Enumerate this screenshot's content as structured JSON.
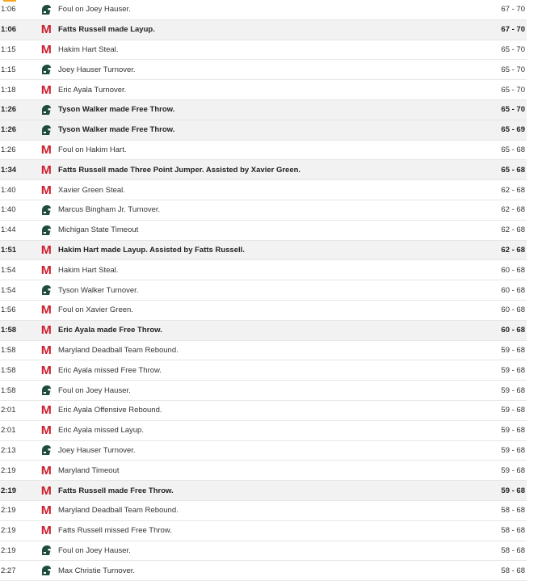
{
  "colors": {
    "maryland_red": "#cc1f2f",
    "msu_green": "#1f4d3c",
    "scoring_row_bg": "#f2f2f2",
    "row_border": "#e6e6e6"
  },
  "teams": {
    "md": {
      "icon": "maryland-m-logo-icon"
    },
    "msu": {
      "icon": "spartan-helmet-logo-icon"
    }
  },
  "plays": [
    {
      "time": "1:06",
      "team": "msu",
      "desc": "Foul on Joey Hauser.",
      "score": "67 - 70",
      "scoring": false
    },
    {
      "time": "1:06",
      "team": "md",
      "desc": "Fatts Russell made Layup.",
      "score": "67 - 70",
      "scoring": true
    },
    {
      "time": "1:15",
      "team": "md",
      "desc": "Hakim Hart Steal.",
      "score": "65 - 70",
      "scoring": false
    },
    {
      "time": "1:15",
      "team": "msu",
      "desc": "Joey Hauser Turnover.",
      "score": "65 - 70",
      "scoring": false
    },
    {
      "time": "1:18",
      "team": "md",
      "desc": "Eric Ayala Turnover.",
      "score": "65 - 70",
      "scoring": false
    },
    {
      "time": "1:26",
      "team": "msu",
      "desc": "Tyson Walker made Free Throw.",
      "score": "65 - 70",
      "scoring": true
    },
    {
      "time": "1:26",
      "team": "msu",
      "desc": "Tyson Walker made Free Throw.",
      "score": "65 - 69",
      "scoring": true
    },
    {
      "time": "1:26",
      "team": "md",
      "desc": "Foul on Hakim Hart.",
      "score": "65 - 68",
      "scoring": false
    },
    {
      "time": "1:34",
      "team": "md",
      "desc": "Fatts Russell made Three Point Jumper. Assisted by Xavier Green.",
      "score": "65 - 68",
      "scoring": true
    },
    {
      "time": "1:40",
      "team": "md",
      "desc": "Xavier Green Steal.",
      "score": "62 - 68",
      "scoring": false
    },
    {
      "time": "1:40",
      "team": "msu",
      "desc": "Marcus Bingham Jr. Turnover.",
      "score": "62 - 68",
      "scoring": false
    },
    {
      "time": "1:44",
      "team": "msu",
      "desc": "Michigan State Timeout",
      "score": "62 - 68",
      "scoring": false
    },
    {
      "time": "1:51",
      "team": "md",
      "desc": "Hakim Hart made Layup. Assisted by Fatts Russell.",
      "score": "62 - 68",
      "scoring": true
    },
    {
      "time": "1:54",
      "team": "md",
      "desc": "Hakim Hart Steal.",
      "score": "60 - 68",
      "scoring": false
    },
    {
      "time": "1:54",
      "team": "msu",
      "desc": "Tyson Walker Turnover.",
      "score": "60 - 68",
      "scoring": false
    },
    {
      "time": "1:56",
      "team": "md",
      "desc": "Foul on Xavier Green.",
      "score": "60 - 68",
      "scoring": false
    },
    {
      "time": "1:58",
      "team": "md",
      "desc": "Eric Ayala made Free Throw.",
      "score": "60 - 68",
      "scoring": true
    },
    {
      "time": "1:58",
      "team": "md",
      "desc": "Maryland Deadball Team Rebound.",
      "score": "59 - 68",
      "scoring": false
    },
    {
      "time": "1:58",
      "team": "md",
      "desc": "Eric Ayala missed Free Throw.",
      "score": "59 - 68",
      "scoring": false
    },
    {
      "time": "1:58",
      "team": "msu",
      "desc": "Foul on Joey Hauser.",
      "score": "59 - 68",
      "scoring": false
    },
    {
      "time": "2:01",
      "team": "md",
      "desc": "Eric Ayala Offensive Rebound.",
      "score": "59 - 68",
      "scoring": false
    },
    {
      "time": "2:01",
      "team": "md",
      "desc": "Eric Ayala missed Layup.",
      "score": "59 - 68",
      "scoring": false
    },
    {
      "time": "2:13",
      "team": "msu",
      "desc": "Joey Hauser Turnover.",
      "score": "59 - 68",
      "scoring": false
    },
    {
      "time": "2:19",
      "team": "md",
      "desc": "Maryland Timeout",
      "score": "59 - 68",
      "scoring": false
    },
    {
      "time": "2:19",
      "team": "md",
      "desc": "Fatts Russell made Free Throw.",
      "score": "59 - 68",
      "scoring": true
    },
    {
      "time": "2:19",
      "team": "md",
      "desc": "Maryland Deadball Team Rebound.",
      "score": "58 - 68",
      "scoring": false
    },
    {
      "time": "2:19",
      "team": "md",
      "desc": "Fatts Russell missed Free Throw.",
      "score": "58 - 68",
      "scoring": false
    },
    {
      "time": "2:19",
      "team": "msu",
      "desc": "Foul on Joey Hauser.",
      "score": "58 - 68",
      "scoring": false
    },
    {
      "time": "2:27",
      "team": "msu",
      "desc": "Max Christie Turnover.",
      "score": "58 - 68",
      "scoring": false
    }
  ]
}
